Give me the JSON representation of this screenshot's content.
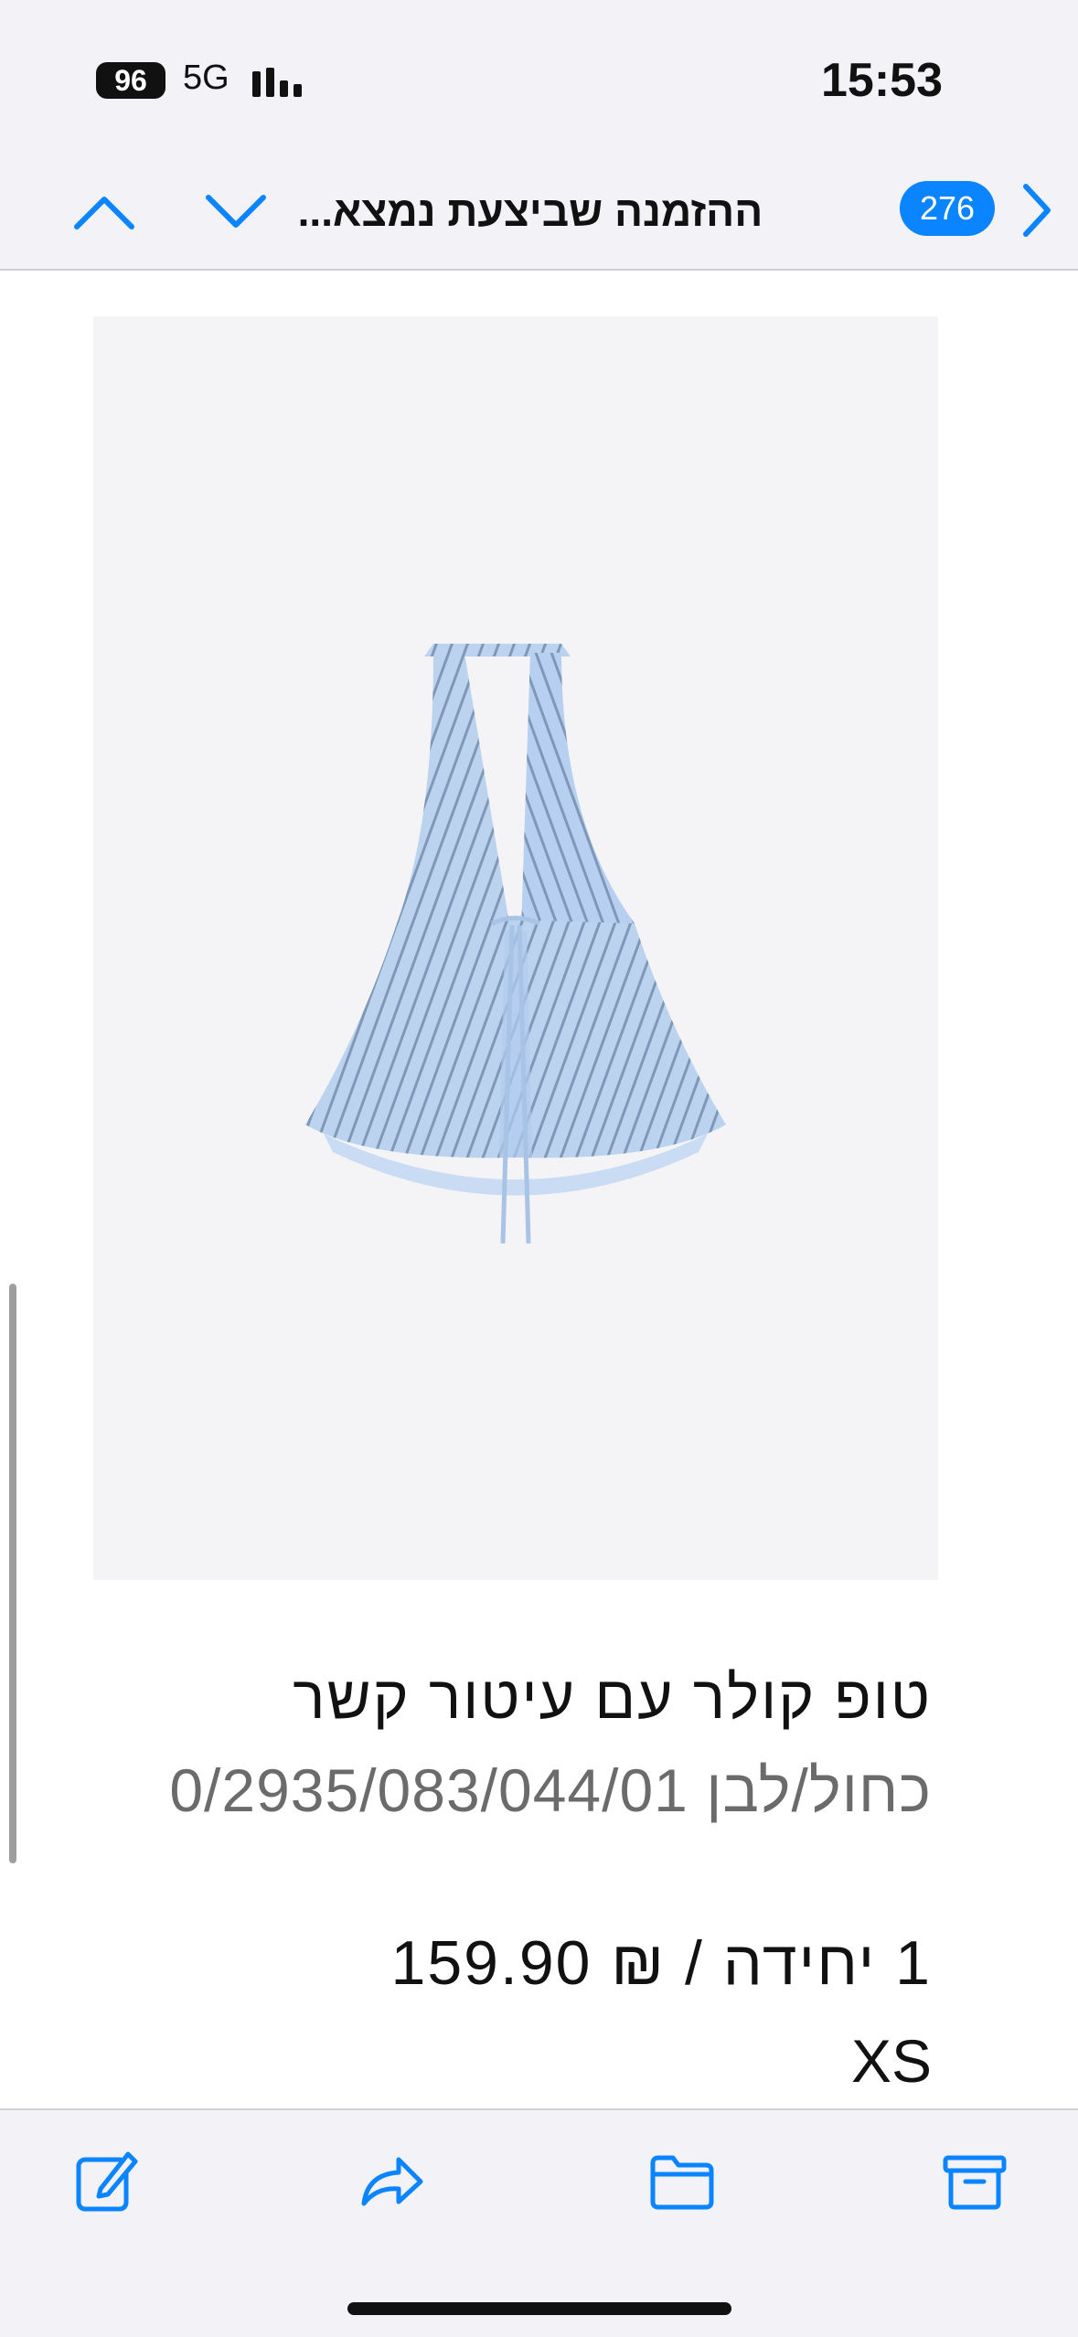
{
  "status_bar": {
    "battery": "96",
    "network": "5G",
    "time": "15:53",
    "icons": [
      "signal-bars-icon"
    ]
  },
  "nav_bar": {
    "subject": "ההזמנה שביצעת נמצא...",
    "message_count": "276",
    "icons": [
      "chevron-up-icon",
      "chevron-down-icon",
      "chevron-right-icon"
    ]
  },
  "product": {
    "name": "טופ קולר עם עיטור קשר",
    "color_ref": "כחול/לבן 0/2935/083/044/01",
    "qty_price": "1 יחידה / ₪ 159.90",
    "size": "XS",
    "image": "striped-halter-top"
  },
  "toolbar": {
    "icons": [
      "compose-icon",
      "reply-forward-icon",
      "folder-icon",
      "archive-icon"
    ]
  },
  "colors": {
    "accent": "#0a84ff",
    "bar_background": "#f2f2f7",
    "image_background": "#f4f4f6",
    "secondary_text": "#6b6b6b"
  }
}
